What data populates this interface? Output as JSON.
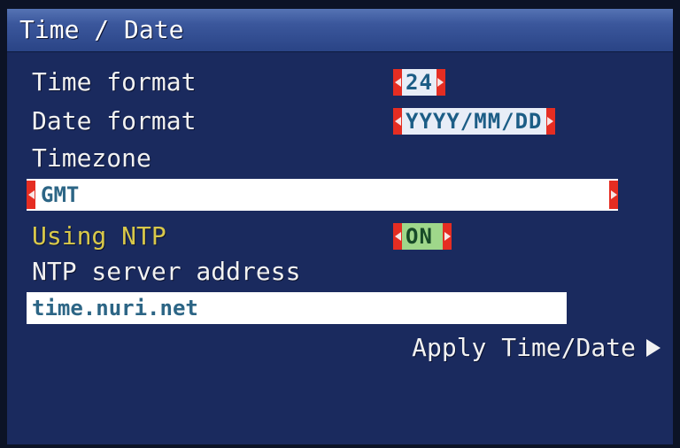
{
  "window": {
    "title": "Time / Date"
  },
  "fields": {
    "time_format": {
      "label": "Time format",
      "value": "24"
    },
    "date_format": {
      "label": "Date format",
      "value": "YYYY/MM/DD"
    },
    "timezone": {
      "label": "Timezone",
      "value": "GMT"
    },
    "ntp": {
      "label": "Using NTP",
      "value": "ON"
    },
    "ntp_server": {
      "label": "NTP server address",
      "value": "time.nuri.net"
    }
  },
  "actions": {
    "apply_label": "Apply Time/Date"
  },
  "colors": {
    "background": "#1a2a5e",
    "title_bar": "#3b579c",
    "arrow_red": "#e52d22",
    "highlight_label": "#d8c84a",
    "on_value": "#9fd78a"
  },
  "icons": [
    "arrow-left-icon",
    "arrow-right-icon",
    "play-arrow-icon"
  ]
}
